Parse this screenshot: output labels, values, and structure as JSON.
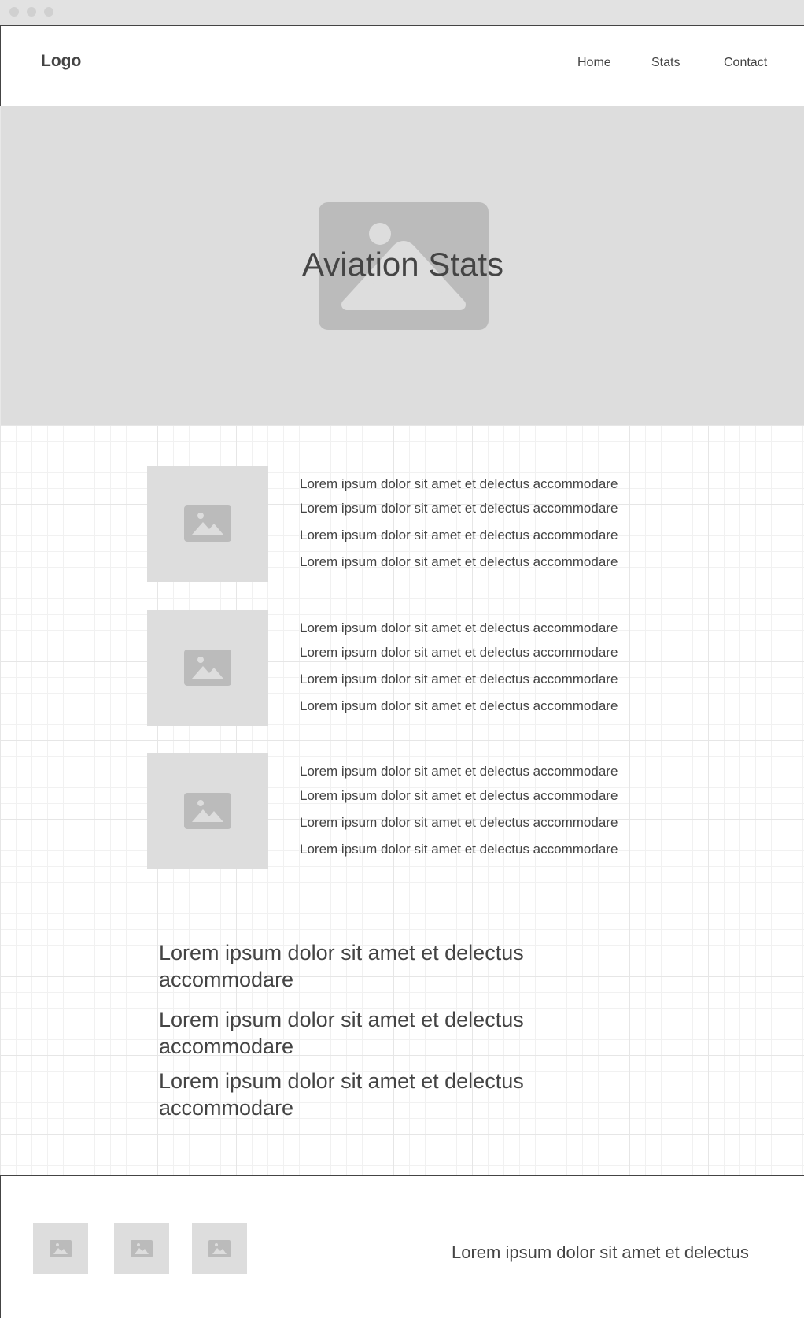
{
  "header": {
    "logo": "Logo",
    "nav": [
      "Home",
      "Stats",
      "Contact"
    ]
  },
  "hero": {
    "title": "Aviation Stats",
    "image_icon": "image-placeholder-icon"
  },
  "rows": [
    {
      "image_icon": "image-placeholder-icon",
      "lines": [
        "Lorem ipsum dolor sit amet et delectus accommodare",
        "Lorem ipsum dolor sit amet et delectus accommodare",
        "Lorem ipsum dolor sit amet et delectus accommodare",
        "Lorem ipsum dolor sit amet et delectus accommodare"
      ]
    },
    {
      "image_icon": "image-placeholder-icon",
      "lines": [
        "Lorem ipsum dolor sit amet et delectus accommodare",
        "Lorem ipsum dolor sit amet et delectus accommodare",
        "Lorem ipsum dolor sit amet et delectus accommodare",
        "Lorem ipsum dolor sit amet et delectus accommodare"
      ]
    },
    {
      "image_icon": "image-placeholder-icon",
      "lines": [
        "Lorem ipsum dolor sit amet et delectus accommodare",
        "Lorem ipsum dolor sit amet et delectus accommodare",
        "Lorem ipsum dolor sit amet et delectus accommodare",
        "Lorem ipsum dolor sit amet et delectus accommodare"
      ]
    }
  ],
  "paragraphs": [
    "Lorem ipsum dolor sit amet et delectus accommodare",
    "Lorem ipsum dolor sit amet et delectus accommodare",
    "Lorem ipsum dolor sit amet et delectus accommodare"
  ],
  "footer": {
    "image_icons": [
      "image-placeholder-icon",
      "image-placeholder-icon",
      "image-placeholder-icon"
    ],
    "text": "Lorem ipsum dolor sit amet et delectus"
  },
  "colors": {
    "placeholder_bg": "#dddddd",
    "placeholder_icon": "#bbbbbb",
    "text": "#444444"
  }
}
